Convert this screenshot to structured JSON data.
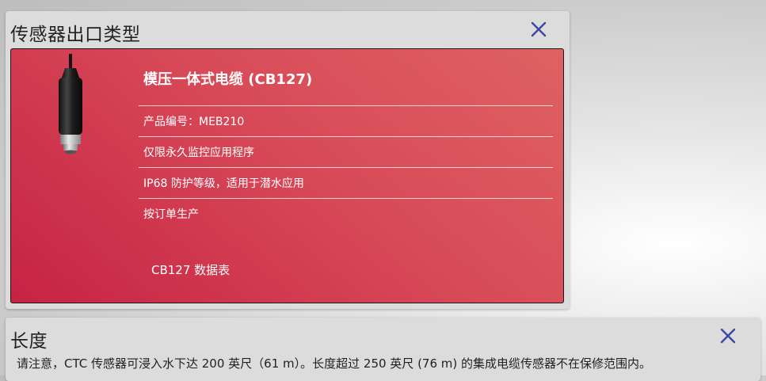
{
  "sensor_type_panel": {
    "title": "传感器出口类型",
    "close_icon": "close-icon",
    "product": {
      "title": "模压一体式电缆 (CB127)",
      "image_icon": "sensor-cable-image",
      "specs": [
        "产品编号：MEB210",
        "仅限永久监控应用程序",
        "IP68 防护等级，适用于潜水应用",
        "按订单生产"
      ],
      "datasheet_link": "CB127 数据表"
    }
  },
  "length_panel": {
    "title": "长度",
    "close_icon": "close-icon",
    "note": "请注意，CTC 传感器可浸入水下达 200 英尺（61 m）。长度超过 250 英尺 (76 m) 的集成电缆传感器不在保修范围内。"
  },
  "colors": {
    "close_icon": "#3d46a8",
    "card_gradient_start": "#de6262",
    "card_gradient_end": "#c62344"
  }
}
